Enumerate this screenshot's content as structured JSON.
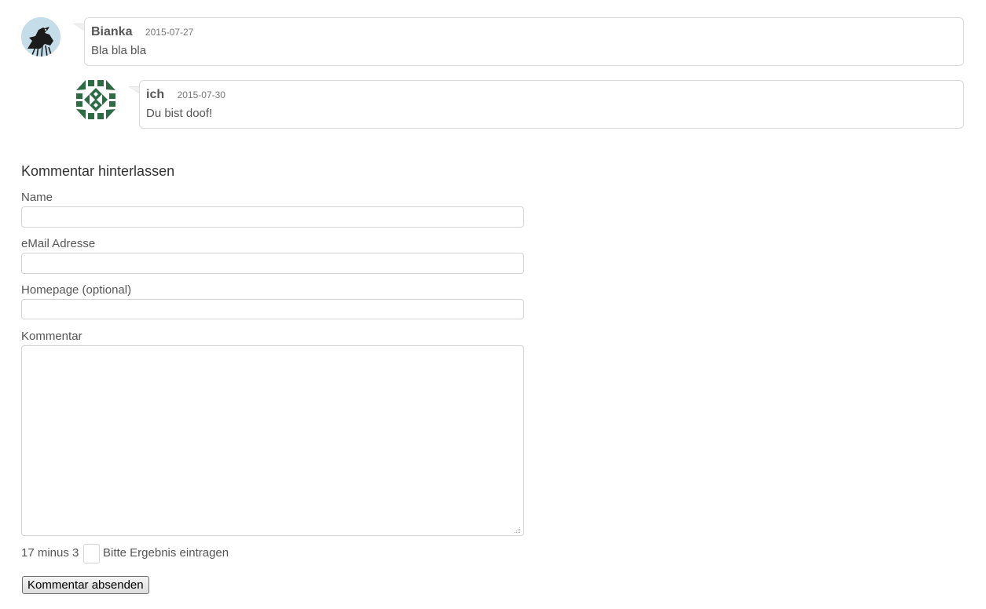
{
  "comments": [
    {
      "author": "Bianka",
      "date": "2015-07-27",
      "text": "Bla bla bla",
      "avatar_icon": "bird-avatar-icon"
    },
    {
      "author": "ich",
      "date": "2015-07-30",
      "text": "Du bist doof!",
      "avatar_icon": "identicon-avatar-icon",
      "avatar_color": "#2e6b45"
    }
  ],
  "form": {
    "title": "Kommentar hinterlassen",
    "name_label": "Name",
    "name_value": "",
    "email_label": "eMail Adresse",
    "email_value": "",
    "homepage_label": "Homepage (optional)",
    "homepage_value": "",
    "comment_label": "Kommentar",
    "comment_value": "",
    "captcha_question": "17 minus 3",
    "captcha_value": "",
    "captcha_hint": "Bitte Ergebnis eintragen",
    "submit_label": "Kommentar absenden"
  }
}
